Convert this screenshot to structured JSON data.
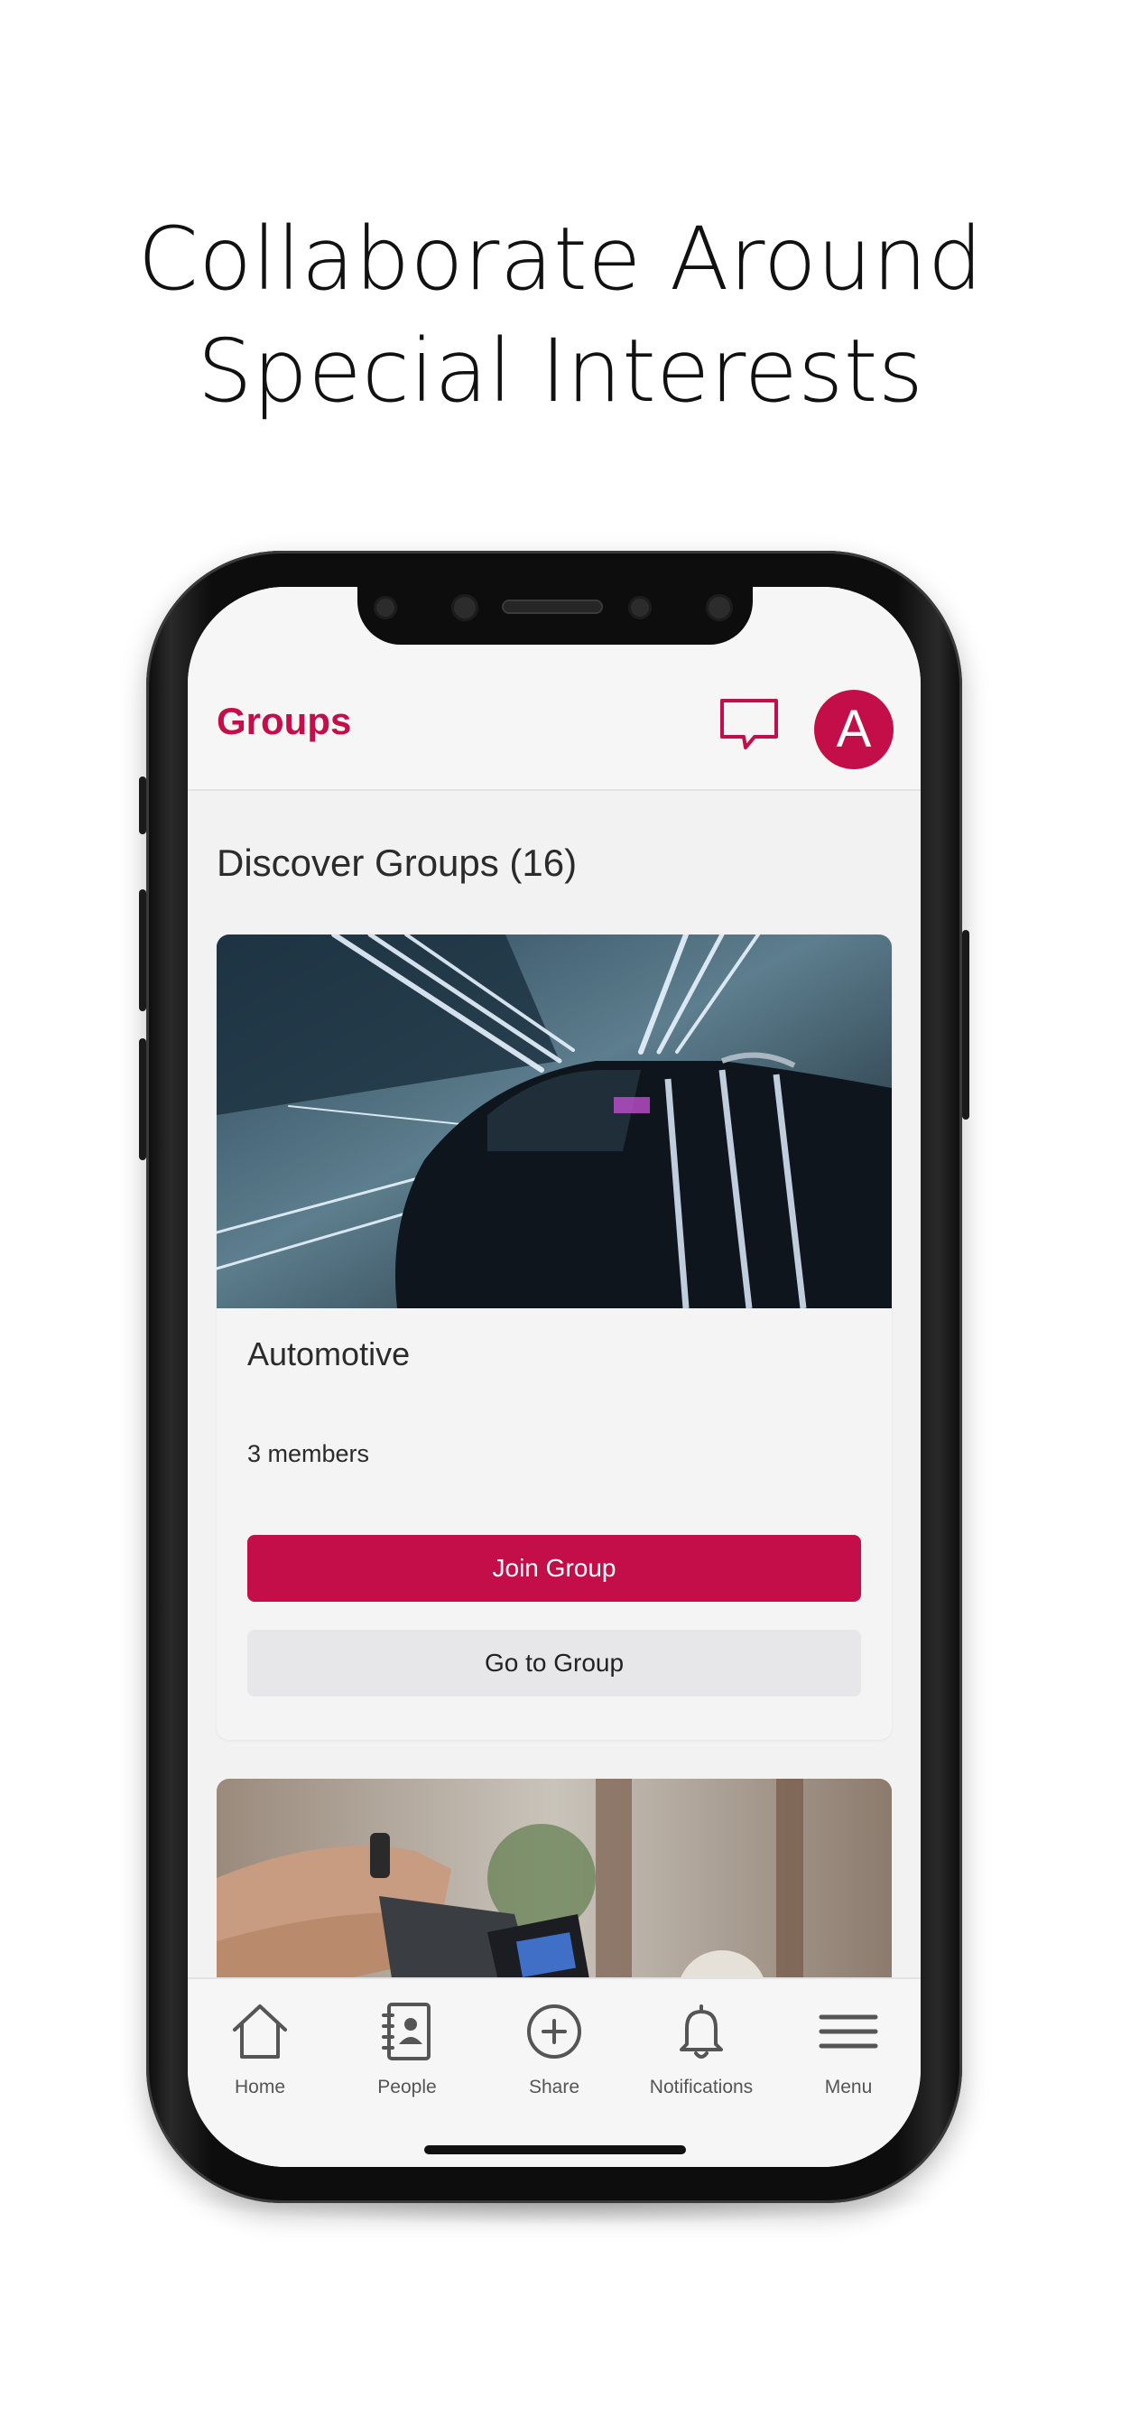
{
  "headline": {
    "line1": "Collaborate Around",
    "line2": "Special Interests"
  },
  "app": {
    "title": "Groups",
    "avatar_initial": "A",
    "accent_color": "#c40e4a"
  },
  "discover": {
    "title": "Discover Groups (16)",
    "cards": [
      {
        "name": "Automotive",
        "members": "3 members",
        "join_label": "Join Group",
        "goto_label": "Go to Group"
      }
    ]
  },
  "tabbar": {
    "items": [
      {
        "label": "Home",
        "icon": "home-icon"
      },
      {
        "label": "People",
        "icon": "contacts-book-icon"
      },
      {
        "label": "Share",
        "icon": "plus-circle-icon"
      },
      {
        "label": "Notifications",
        "icon": "bell-icon"
      },
      {
        "label": "Menu",
        "icon": "hamburger-menu-icon"
      }
    ]
  }
}
